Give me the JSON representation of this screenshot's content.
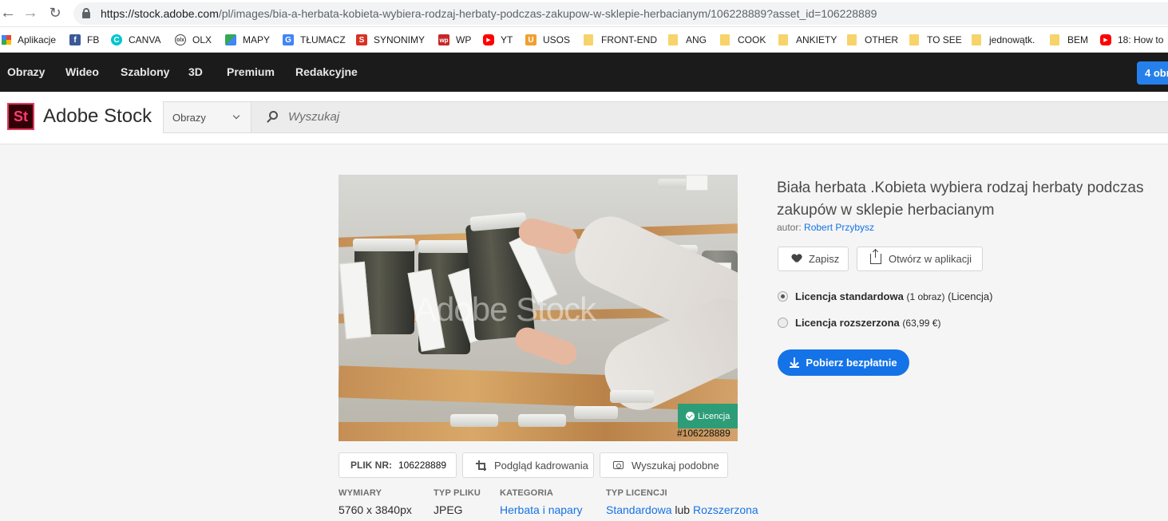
{
  "browser": {
    "url_host": "https://stock.adobe.com",
    "url_path": "/pl/images/bia-a-herbata-kobieta-wybiera-rodzaj-herbaty-podczas-zakupow-w-sklepie-herbacianym/106228889?asset_id=106228889"
  },
  "bookmarks": [
    {
      "label": "Aplikacje",
      "icon": "apps-grid-icon"
    },
    {
      "label": "FB",
      "icon": "facebook-icon",
      "color": "#3b5998"
    },
    {
      "label": "CANVA",
      "icon": "canva-icon",
      "color": "#00c4cc"
    },
    {
      "label": "OLX",
      "icon": "olx-icon",
      "color": "#444444"
    },
    {
      "label": "MAPY",
      "icon": "maps-icon",
      "color": "#34a853"
    },
    {
      "label": "TŁUMACZ",
      "icon": "translate-icon",
      "color": "#4285f4"
    },
    {
      "label": "SYNONIMY",
      "icon": "synonimy-icon",
      "color": "#d93025"
    },
    {
      "label": "WP",
      "icon": "wp-icon",
      "color": "#c62828"
    },
    {
      "label": "YT",
      "icon": "youtube-icon",
      "color": "#ff0000"
    },
    {
      "label": "USOS",
      "icon": "usos-icon",
      "color": "#f0a030"
    },
    {
      "label": "FRONT-END",
      "icon": "folder-icon"
    },
    {
      "label": "ANG",
      "icon": "folder-icon"
    },
    {
      "label": "COOK",
      "icon": "folder-icon"
    },
    {
      "label": "ANKIETY",
      "icon": "folder-icon"
    },
    {
      "label": "OTHER",
      "icon": "folder-icon"
    },
    {
      "label": "TO SEE",
      "icon": "folder-icon"
    },
    {
      "label": "jednowątk.",
      "icon": "folder-icon"
    },
    {
      "label": "BEM",
      "icon": "folder-icon"
    },
    {
      "label": "18: How to",
      "icon": "youtube-icon",
      "color": "#ff0000"
    }
  ],
  "topnav": {
    "items": [
      "Obrazy",
      "Wideo",
      "Szablony",
      "3D",
      "Premium",
      "Redakcyjne"
    ],
    "cart_label": "4 obr"
  },
  "header": {
    "logo_mark": "St",
    "logo_text": "Adobe Stock",
    "search_category": "Obrazy",
    "search_placeholder": "Wyszukaj"
  },
  "asset": {
    "watermark": "Adobe Stock",
    "license_badge": "Licencja",
    "asset_id_overlay": "#106228889",
    "file_no_label": "PLIK NR:",
    "file_no_value": "106228889",
    "crop_preview_label": "Podgląd kadrowania",
    "find_similar_label": "Wyszukaj podobne",
    "meta": {
      "dimensions_key": "WYMIARY",
      "dimensions_value": "5760 x 3840px",
      "filetype_key": "TYP PLIKU",
      "filetype_value": "JPEG",
      "category_key": "KATEGORIA",
      "category_value": "Herbata i napary",
      "license_type_key": "TYP LICENCJI",
      "license_standard": "Standardowa",
      "license_or": "lub",
      "license_extended": "Rozszerzona"
    }
  },
  "details": {
    "title": "Biała herbata .Kobieta wybiera rodzaj herbaty podczas zakupów w sklepie herbacianym",
    "author_prefix": "autor:",
    "author_name": "Robert Przybysz",
    "save_label": "Zapisz",
    "open_in_app_label": "Otwórz w aplikacji",
    "license_standard_name": "Licencja standardowa",
    "license_standard_note": "(1 obraz)",
    "license_standard_suffix": "(Licencja)",
    "license_extended_name": "Licencja rozszerzona",
    "license_extended_price": "(63,99 €)",
    "download_label": "Pobierz bezpłatnie"
  },
  "colors": {
    "accent": "#1473e6",
    "license_green": "#2d9d78",
    "nav_bg": "#1b1b1b"
  }
}
